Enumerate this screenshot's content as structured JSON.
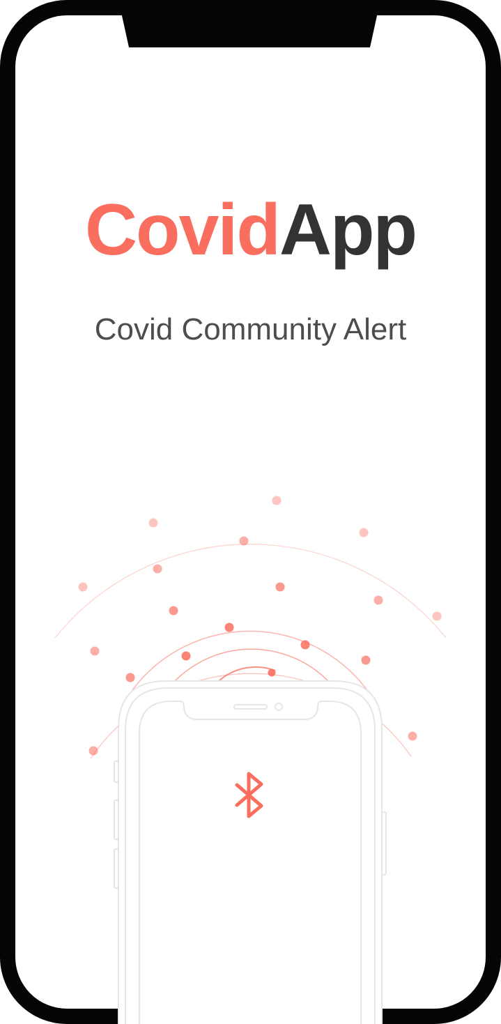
{
  "app": {
    "name_part1": "Covid",
    "name_part2": "App",
    "tagline": "Covid Community Alert"
  },
  "illustration": {
    "center_icon": "bluetooth-icon"
  },
  "colors": {
    "accent": "#f96e5e",
    "dark_text": "#333333",
    "subtitle_text": "#4d4d4d",
    "device_frame": "#050505",
    "phone_outline": "#e6e6e6"
  }
}
